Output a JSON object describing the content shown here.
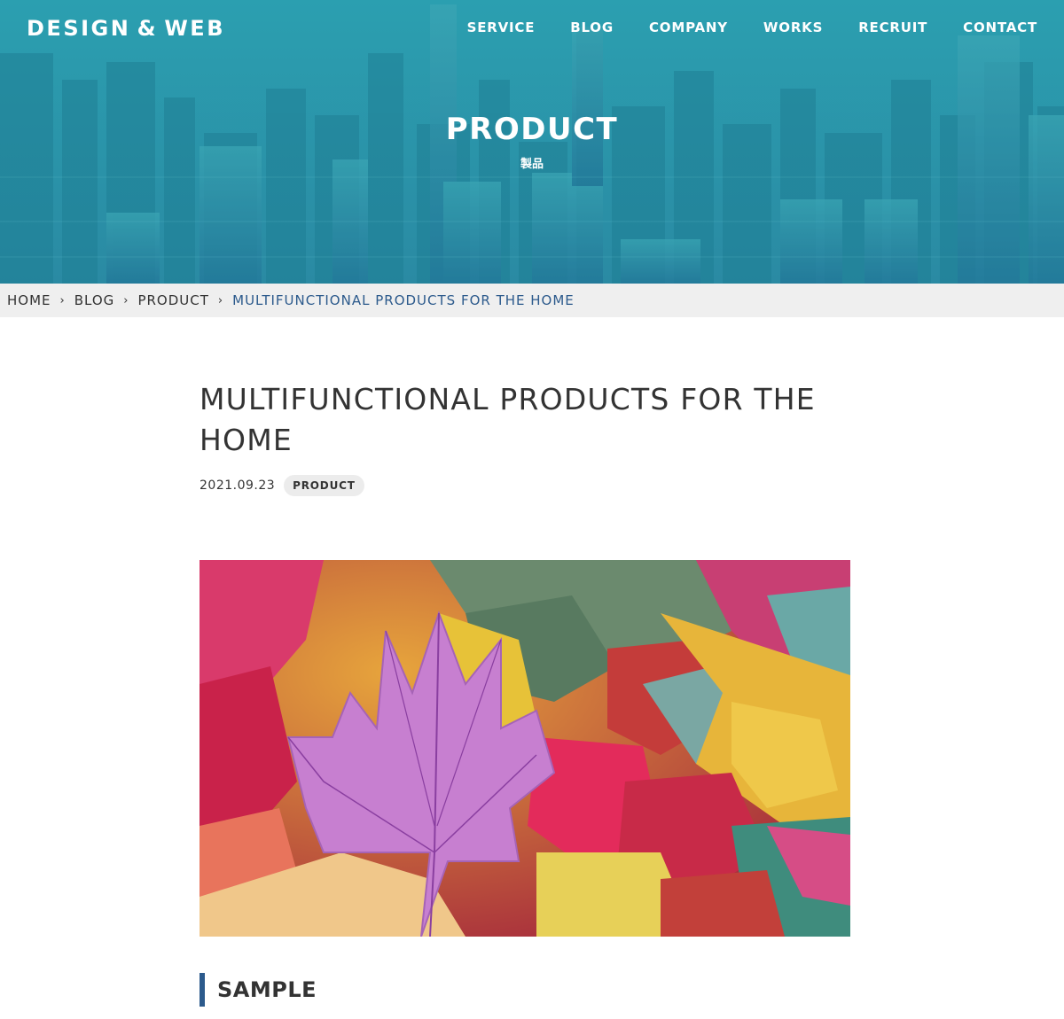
{
  "site": {
    "logo": "DESIGN & WEB"
  },
  "nav": {
    "items": [
      {
        "label": "SERVICE"
      },
      {
        "label": "BLOG"
      },
      {
        "label": "COMPANY"
      },
      {
        "label": "WORKS"
      },
      {
        "label": "RECRUIT"
      },
      {
        "label": "CONTACT"
      }
    ]
  },
  "hero": {
    "title": "PRODUCT",
    "subtitle": "製品"
  },
  "breadcrumb": {
    "items": [
      {
        "label": "HOME"
      },
      {
        "label": "BLOG"
      },
      {
        "label": "PRODUCT"
      }
    ],
    "current": "MULTIFUNCTIONAL PRODUCTS FOR THE HOME",
    "separator": "›"
  },
  "article": {
    "title": "MULTIFUNCTIONAL PRODUCTS FOR THE HOME",
    "date": "2021.09.23",
    "category": "PRODUCT",
    "section_heading": "SAMPLE"
  },
  "colors": {
    "hero_overlay": "#2a9aa8",
    "accent": "#2c5a8c",
    "breadcrumb_bg": "#efefef",
    "badge_bg": "#ececec"
  }
}
